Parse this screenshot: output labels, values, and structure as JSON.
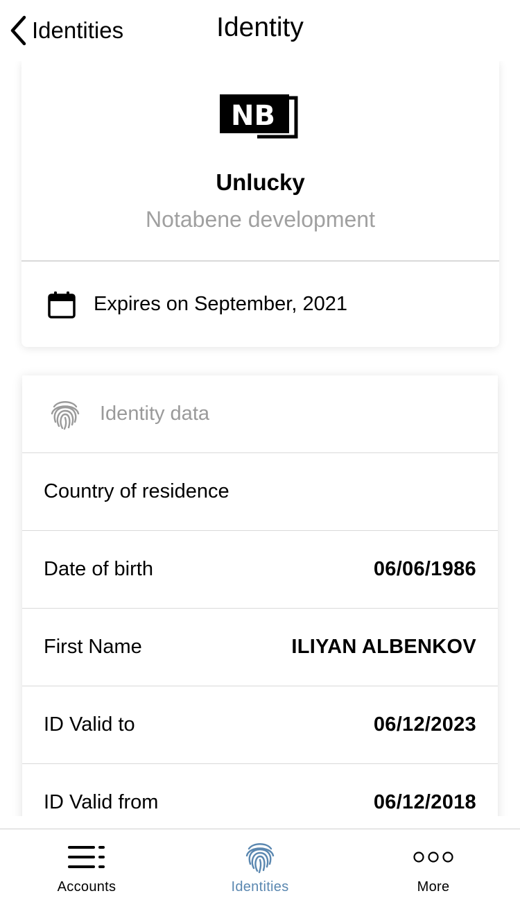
{
  "header": {
    "back_label": "Identities",
    "title": "Identity"
  },
  "profile": {
    "logo_text": "NB",
    "name": "Unlucky",
    "organization": "Notabene development",
    "expiry": "Expires on September, 2021"
  },
  "identity_data": {
    "section_label": "Identity data",
    "rows": [
      {
        "label": "Country of residence",
        "value": ""
      },
      {
        "label": "Date of birth",
        "value": "06/06/1986"
      },
      {
        "label": "First Name",
        "value": "ILIYAN ALBENKOV"
      },
      {
        "label": "ID Valid to",
        "value": "06/12/2023"
      },
      {
        "label": "ID Valid from",
        "value": "06/12/2018"
      }
    ]
  },
  "tabbar": {
    "active_color": "#5a87b0",
    "inactive_color": "#000000",
    "tabs": [
      {
        "label": "Accounts",
        "icon": "accounts-icon",
        "active": false
      },
      {
        "label": "Identities",
        "icon": "fingerprint-icon",
        "active": true
      },
      {
        "label": "More",
        "icon": "more-icon",
        "active": false
      }
    ]
  }
}
